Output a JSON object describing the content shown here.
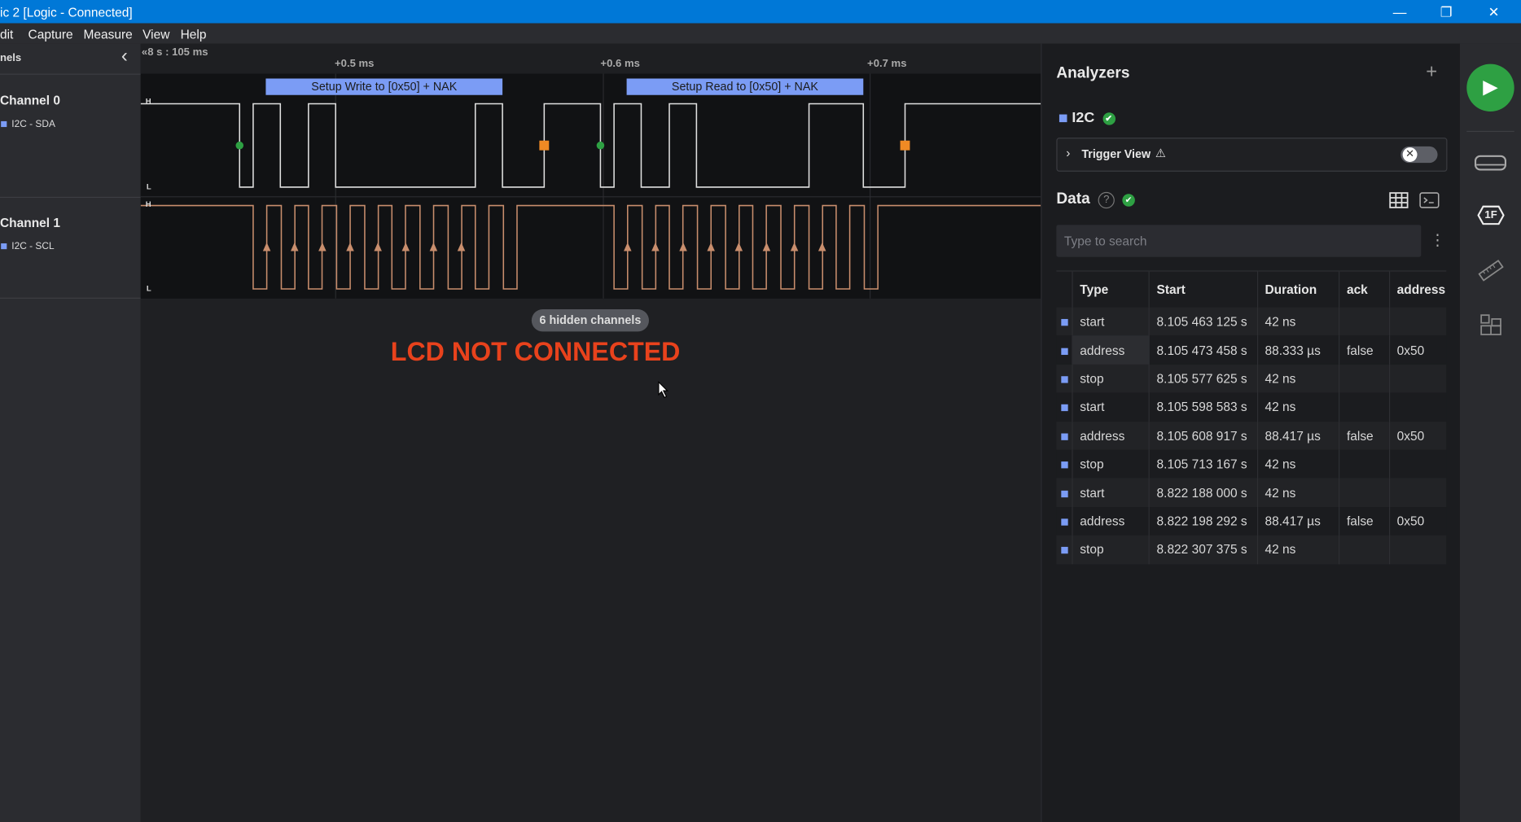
{
  "window": {
    "title": "ic 2 [Logic - Connected]",
    "minimize": "—",
    "restore": "❐",
    "close": "✕"
  },
  "menu": [
    "dit",
    "Capture",
    "Measure",
    "View",
    "Help"
  ],
  "channels_panel": {
    "title": "nels",
    "collapse": "‹",
    "channels": [
      {
        "name": "Channel 0",
        "signal": "I2C - SDA",
        "high": "H",
        "low": "L"
      },
      {
        "name": "Channel 1",
        "signal": "I2C - SCL",
        "high": "H",
        "low": "L"
      }
    ]
  },
  "ruler": {
    "origin": "«8 s : 105 ms",
    "ticks": [
      "+0.5 ms",
      "+0.6 ms",
      "+0.7 ms"
    ]
  },
  "annotations": [
    "Setup Write to [0x50] + NAK",
    "Setup Read to [0x50] + NAK"
  ],
  "hidden_channels": "6 hidden channels",
  "overlay_text": "LCD NOT CONNECTED",
  "analyzers": {
    "title": "Analyzers",
    "add": "+",
    "analyzer": {
      "name": "I2C",
      "status": "✔"
    },
    "trigger_view": {
      "label": "Trigger View",
      "warning": "⚠",
      "enabled": false
    }
  },
  "data": {
    "title": "Data",
    "help": "?",
    "status": "✔",
    "search_placeholder": "Type to search",
    "more": "⋮",
    "columns": [
      "Type",
      "Start",
      "Duration",
      "ack",
      "address"
    ],
    "rows": [
      [
        "start",
        "8.105 463 125 s",
        "42 ns",
        "",
        ""
      ],
      [
        "address",
        "8.105 473 458 s",
        "88.333 µs",
        "false",
        "0x50"
      ],
      [
        "stop",
        "8.105 577 625 s",
        "42 ns",
        "",
        ""
      ],
      [
        "start",
        "8.105 598 583 s",
        "42 ns",
        "",
        ""
      ],
      [
        "address",
        "8.105 608 917 s",
        "88.417 µs",
        "false",
        "0x50"
      ],
      [
        "stop",
        "8.105 713 167 s",
        "42 ns",
        "",
        ""
      ],
      [
        "start",
        "8.822 188 000 s",
        "42 ns",
        "",
        ""
      ],
      [
        "address",
        "8.822 198 292 s",
        "88.417 µs",
        "false",
        "0x50"
      ],
      [
        "stop",
        "8.822 307 375 s",
        "42 ns",
        "",
        ""
      ]
    ]
  },
  "sidebar": {
    "run": "▶",
    "extensions_label": "1F"
  },
  "colors": {
    "accent": "#0078d7",
    "sda": "#e0e0e0",
    "scl": "#c98e6d",
    "annotation": "#7b9cf5",
    "start_marker": "#2ea043",
    "stop_marker": "#f08a24",
    "lcd": "#e8421c"
  }
}
